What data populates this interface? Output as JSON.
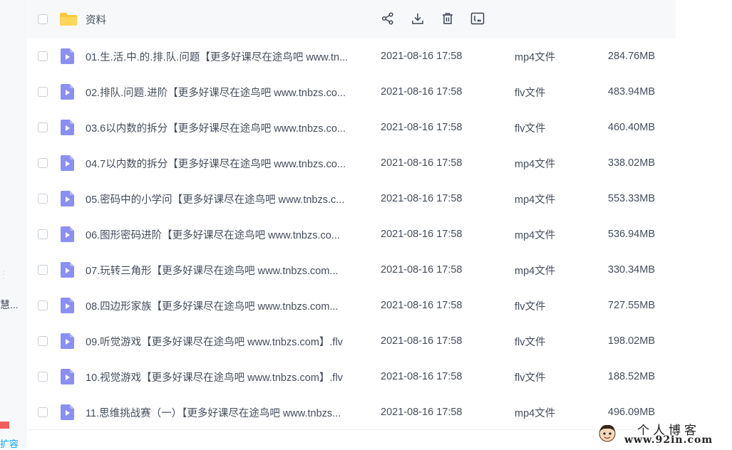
{
  "sidebar": {
    "truncated_text": "慧...",
    "expand_label": "扩容"
  },
  "header": {
    "folder_name": "资料"
  },
  "files": [
    {
      "name": "01.生.活.中.的.排.队.问题【更多好课尽在途鸟吧 www.tn...",
      "date": "2021-08-16 17:58",
      "type": "mp4文件",
      "size": "284.76MB"
    },
    {
      "name": "02.排队.问题.进阶【更多好课尽在途鸟吧 www.tnbzs.co...",
      "date": "2021-08-16 17:58",
      "type": "flv文件",
      "size": "483.94MB"
    },
    {
      "name": "03.6以内数的拆分【更多好课尽在途鸟吧 www.tnbzs.co...",
      "date": "2021-08-16 17:58",
      "type": "flv文件",
      "size": "460.40MB"
    },
    {
      "name": "04.7以内数的拆分【更多好课尽在途鸟吧 www.tnbzs.co...",
      "date": "2021-08-16 17:58",
      "type": "mp4文件",
      "size": "338.02MB"
    },
    {
      "name": "05.密码中的小学问【更多好课尽在途鸟吧 www.tnbzs.c...",
      "date": "2021-08-16 17:58",
      "type": "mp4文件",
      "size": "553.33MB"
    },
    {
      "name": "06.图形密码进阶【更多好课尽在途鸟吧 www.tnbzs.co...",
      "date": "2021-08-16 17:58",
      "type": "mp4文件",
      "size": "536.94MB"
    },
    {
      "name": "07.玩转三角形【更多好课尽在途鸟吧 www.tnbzs.com...",
      "date": "2021-08-16 17:58",
      "type": "mp4文件",
      "size": "330.34MB"
    },
    {
      "name": "08.四边形家族【更多好课尽在途鸟吧 www.tnbzs.com...",
      "date": "2021-08-16 17:58",
      "type": "flv文件",
      "size": "727.55MB"
    },
    {
      "name": "09.听觉游戏【更多好课尽在途鸟吧 www.tnbzs.com】.flv",
      "date": "2021-08-16 17:58",
      "type": "flv文件",
      "size": "198.02MB"
    },
    {
      "name": "10.视觉游戏【更多好课尽在途鸟吧 www.tnbzs.com】.flv",
      "date": "2021-08-16 17:58",
      "type": "flv文件",
      "size": "188.52MB"
    },
    {
      "name": "11.思维挑战赛（一）【更多好课尽在途鸟吧 www.tnbzs...",
      "date": "2021-08-16 17:58",
      "type": "mp4文件",
      "size": "496.09MB"
    }
  ],
  "watermark": {
    "title": "个人博客",
    "site": "www.92in.com"
  },
  "colors": {
    "video_icon": "#8b8ff2",
    "folder_icon": "#fdc83a",
    "accent": "#06a7ff"
  }
}
